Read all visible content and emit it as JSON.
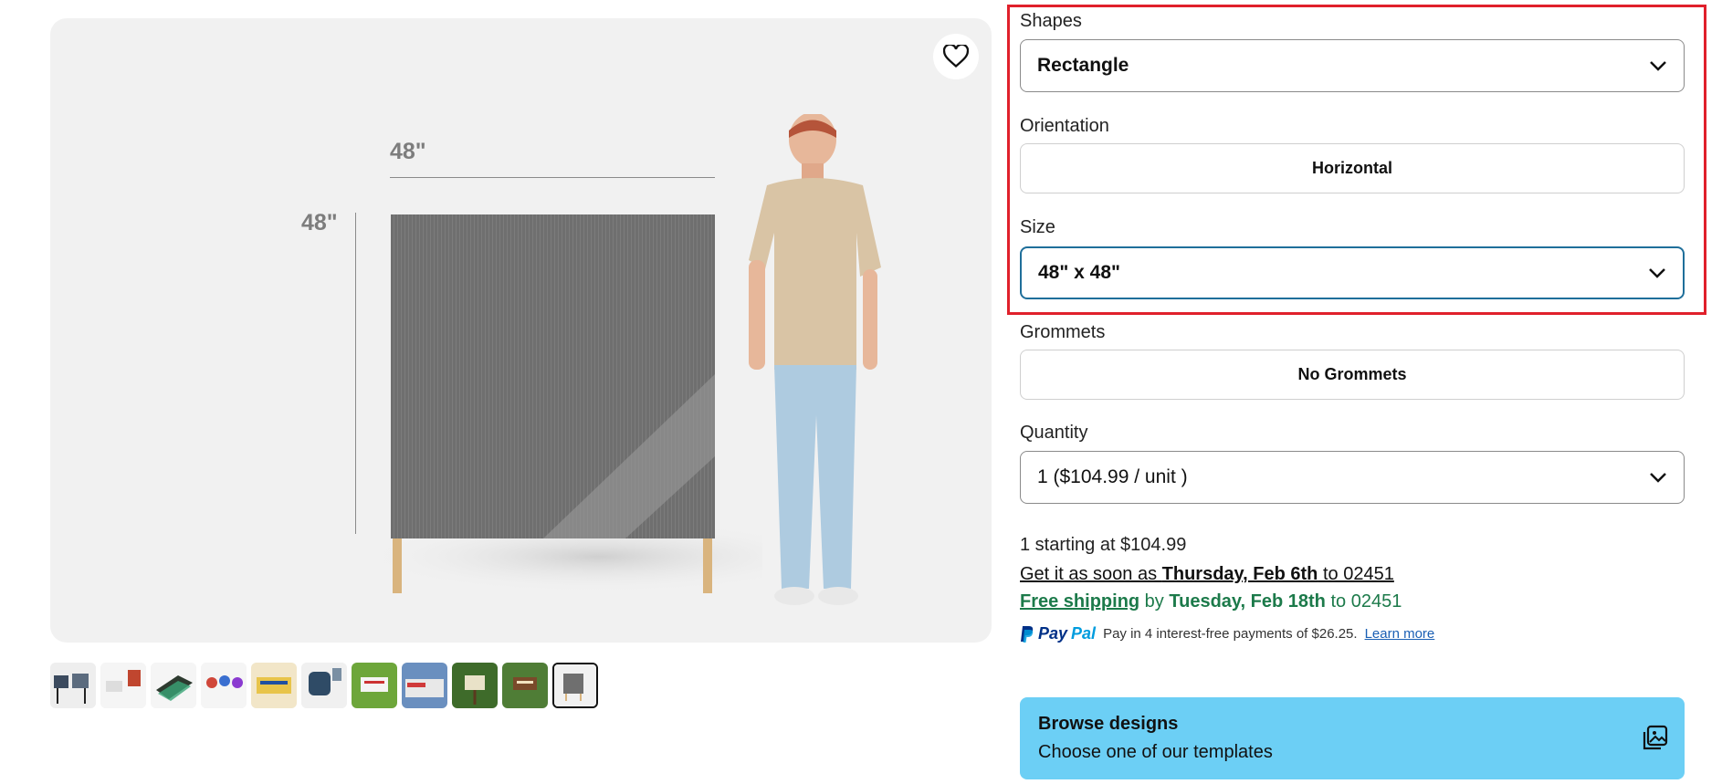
{
  "gallery": {
    "dim_width": "48\"",
    "dim_height": "48\"",
    "thumbnail_count": 11,
    "selected_thumbnail_index": 10
  },
  "options": {
    "shapes": {
      "label": "Shapes",
      "value": "Rectangle"
    },
    "orientation": {
      "label": "Orientation",
      "value": "Horizontal"
    },
    "size": {
      "label": "Size",
      "value": "48\" x 48\""
    },
    "grommets": {
      "label": "Grommets",
      "value": "No Grommets"
    },
    "quantity": {
      "label": "Quantity",
      "value": "1 ($104.99 / unit )"
    }
  },
  "pricing": {
    "starting": "1 starting at $104.99",
    "delivery_prefix": "Get it as soon as ",
    "delivery_date": "Thursday, Feb 6th",
    "delivery_suffix": " to 02451",
    "free_shipping": "Free shipping",
    "shipping_by": " by ",
    "shipping_date": "Tuesday, Feb 18th",
    "shipping_suffix": " to 02451"
  },
  "paypal": {
    "logo_pay": "Pay",
    "logo_pal": "Pal",
    "text": "Pay in 4 interest-free payments of $26.25.",
    "learn_more": "Learn more"
  },
  "browse": {
    "title": "Browse designs",
    "subtitle": "Choose one of our templates"
  },
  "colors": {
    "highlight": "#e0202b",
    "focus_border": "#1f6f9a",
    "shipping_green": "#1c7a4a",
    "browse_bg": "#6ccff5"
  }
}
